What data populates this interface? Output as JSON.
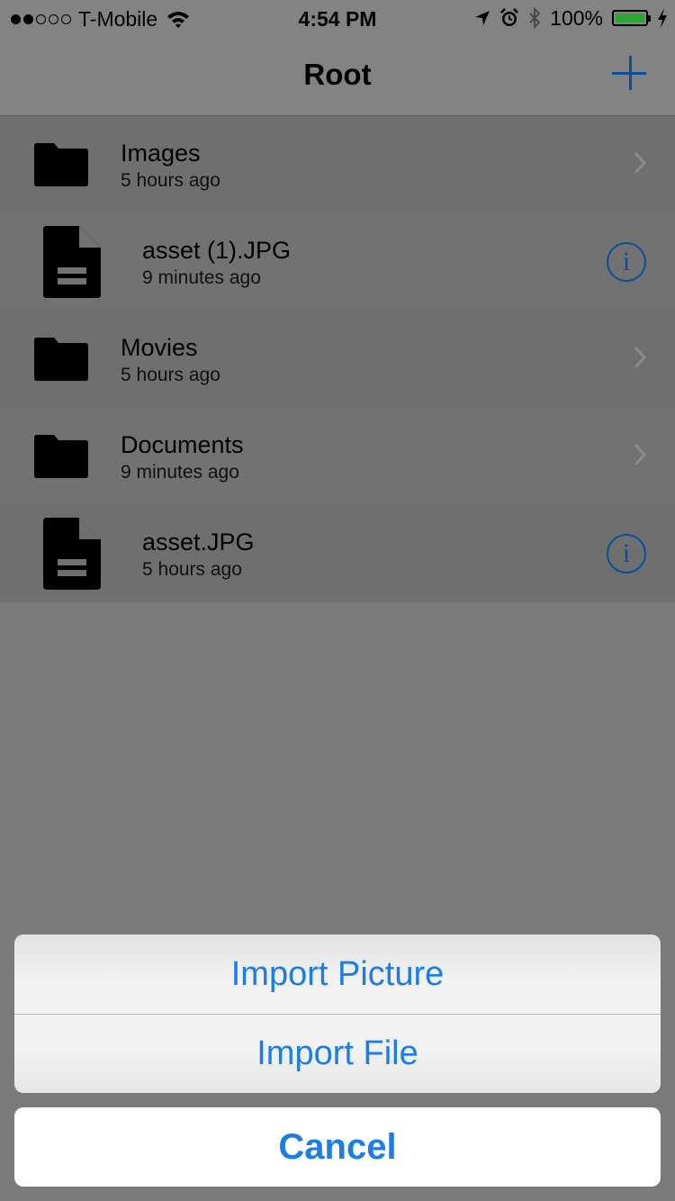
{
  "status_bar": {
    "carrier": "T-Mobile",
    "signal_bars_filled": 2,
    "signal_bars_total": 5,
    "time": "4:54 PM",
    "battery_percent": "100%",
    "icons": [
      "wifi-icon",
      "location-arrow-icon",
      "alarm-clock-icon",
      "bluetooth-icon",
      "battery-icon",
      "charging-bolt-icon"
    ]
  },
  "nav": {
    "title": "Root",
    "add_icon": "plus-icon"
  },
  "items": [
    {
      "type": "folder",
      "name": "Images",
      "modified": "5 hours ago",
      "accessory": "chevron-right-icon"
    },
    {
      "type": "file",
      "name": "asset (1).JPG",
      "modified": "9 minutes ago",
      "accessory": "info-icon"
    },
    {
      "type": "folder",
      "name": "Movies",
      "modified": "5 hours ago",
      "accessory": "chevron-right-icon"
    },
    {
      "type": "folder",
      "name": "Documents",
      "modified": "9 minutes ago",
      "accessory": "chevron-right-icon"
    },
    {
      "type": "file",
      "name": "asset.JPG",
      "modified": "5 hours ago",
      "accessory": "info-icon"
    }
  ],
  "action_sheet": {
    "options": [
      "Import Picture",
      "Import File"
    ],
    "cancel": "Cancel"
  },
  "colors": {
    "accent": "#1a7ee6",
    "nav_accent": "#0a4e9c",
    "battery": "#2ea433"
  }
}
